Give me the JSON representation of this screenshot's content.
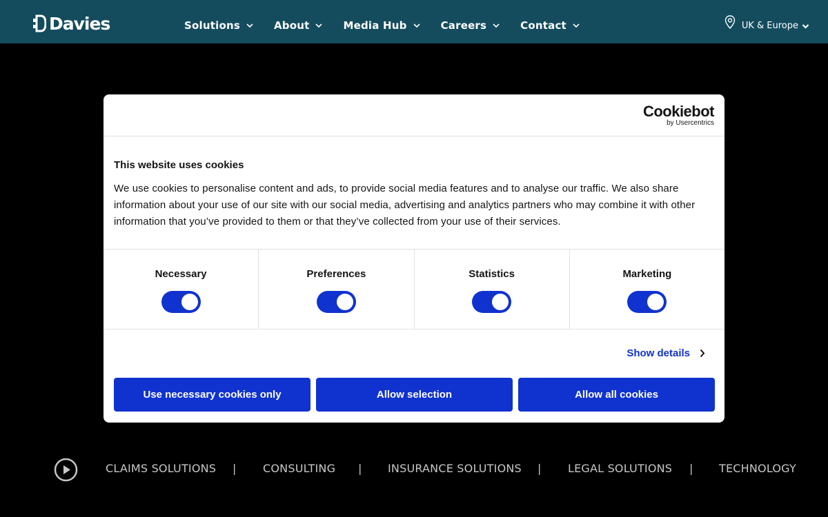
{
  "header": {
    "logo_text": "Davies",
    "nav": [
      {
        "label": "Solutions"
      },
      {
        "label": "About"
      },
      {
        "label": "Media Hub"
      },
      {
        "label": "Careers"
      },
      {
        "label": "Contact"
      }
    ],
    "region_label": "UK & Europe"
  },
  "cookie_dialog": {
    "brand_name": "Cookiebot",
    "brand_sub": "by Usercentrics",
    "title": "This website uses cookies",
    "text": "We use cookies to personalise content and ads, to provide social media features and to analyse our traffic. We also share information about your use of our site with our social media, advertising and analytics partners who may combine it with other information that you’ve provided to them or that they’ve collected from your use of their services.",
    "toggles": [
      {
        "label": "Necessary",
        "on": true
      },
      {
        "label": "Preferences",
        "on": true
      },
      {
        "label": "Statistics",
        "on": true
      },
      {
        "label": "Marketing",
        "on": true
      }
    ],
    "show_details": "Show details",
    "buttons": {
      "necessary_only": "Use necessary cookies only",
      "allow_selection": "Allow selection",
      "allow_all": "Allow all cookies"
    },
    "accent_color": "#1032cf"
  },
  "solutions_strip": {
    "items": [
      "CLAIMS SOLUTIONS",
      "CONSULTING",
      "INSURANCE SOLUTIONS",
      "LEGAL SOLUTIONS",
      "TECHNOLOGY"
    ],
    "separator": "|"
  },
  "colors": {
    "header_bg": "#144c5e",
    "page_bg": "#000000"
  }
}
